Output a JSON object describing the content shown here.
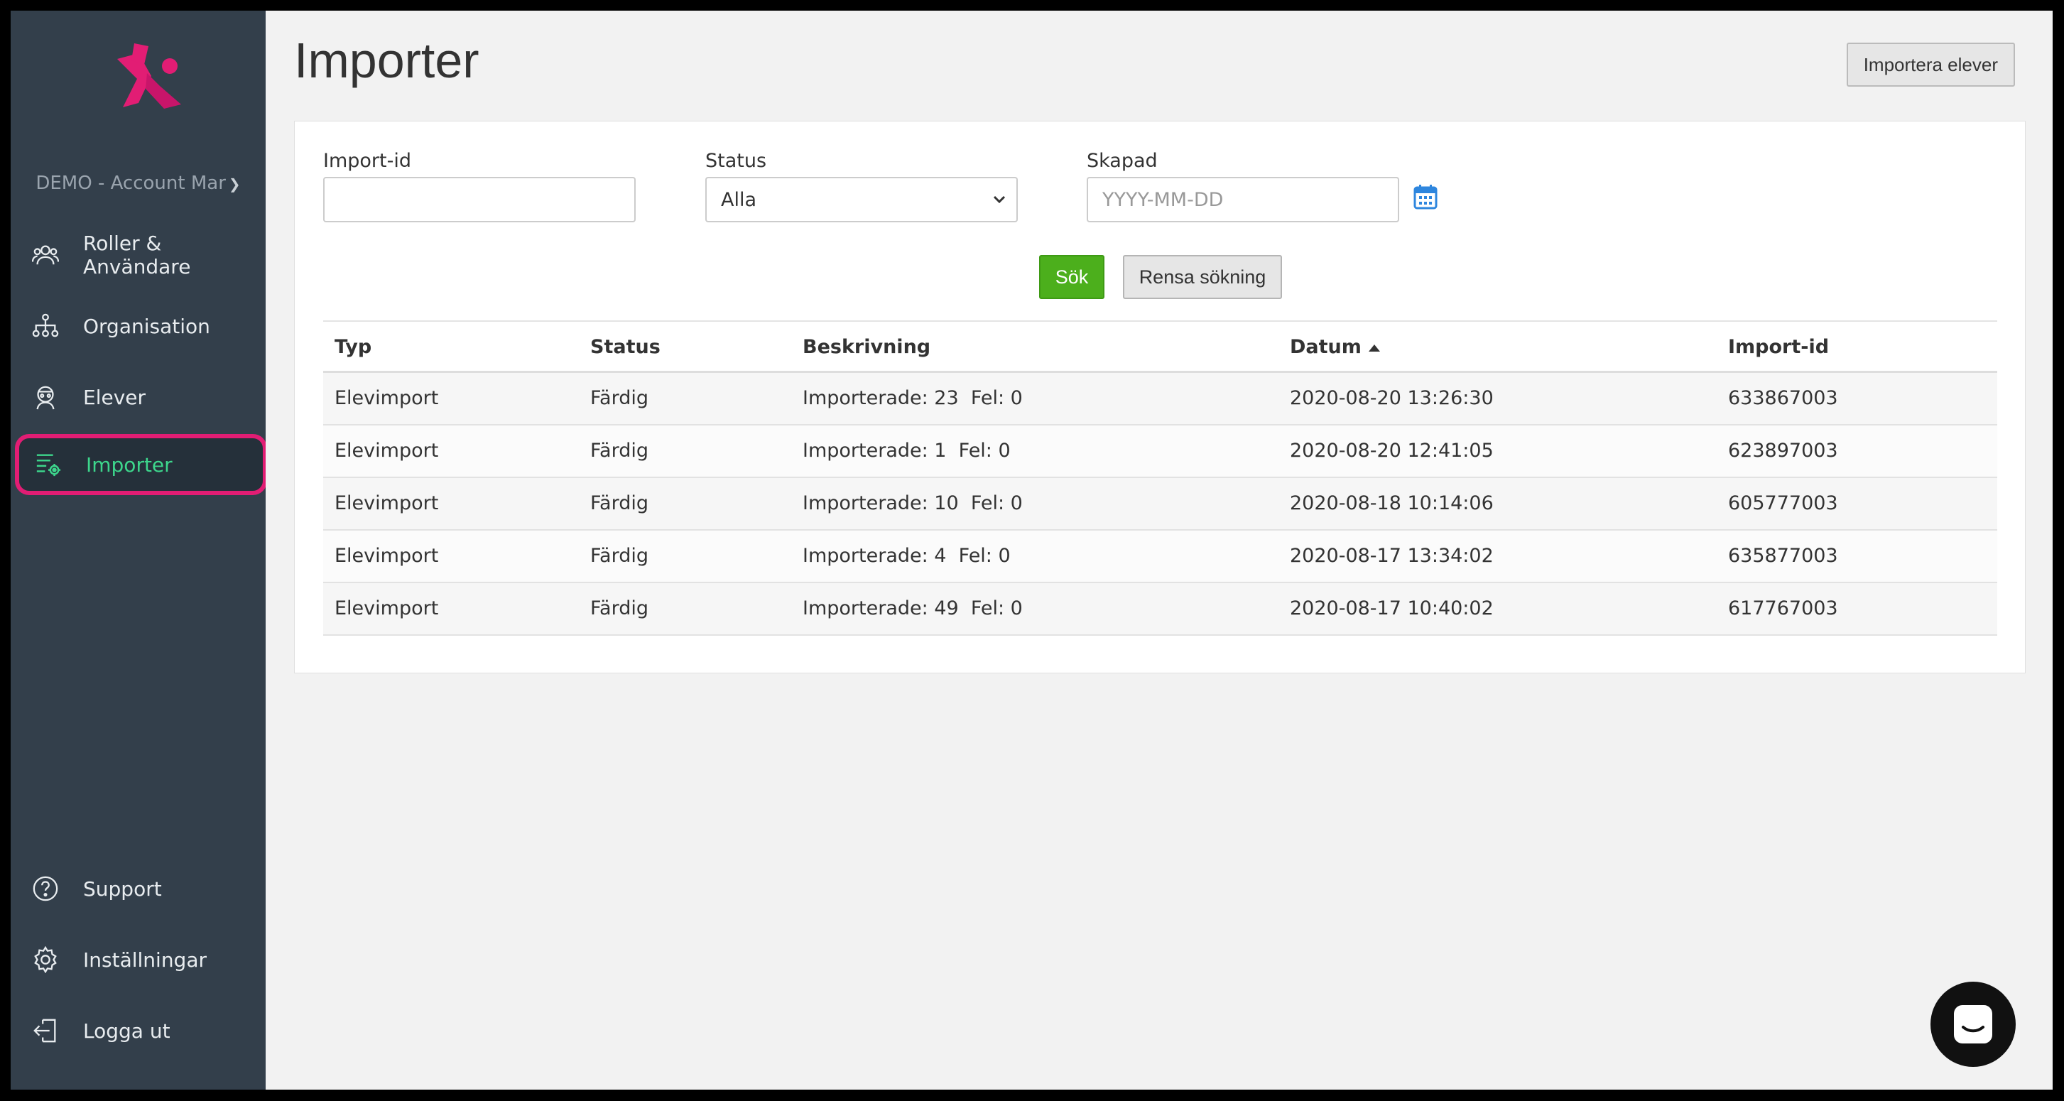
{
  "sidebar": {
    "account": "DEMO - Account Mar",
    "items": [
      {
        "label": "Roller & Användare",
        "icon": "users-icon"
      },
      {
        "label": "Organisation",
        "icon": "org-tree-icon"
      },
      {
        "label": "Elever",
        "icon": "student-icon"
      },
      {
        "label": "Importer",
        "icon": "import-gear-icon",
        "active": true
      }
    ],
    "bottom_items": [
      {
        "label": "Support",
        "icon": "help-icon"
      },
      {
        "label": "Inställningar",
        "icon": "gear-icon"
      },
      {
        "label": "Logga ut",
        "icon": "logout-icon"
      }
    ],
    "colors": {
      "bg": "#333f4b",
      "active_border": "#e21d74",
      "active_text": "#3dd68c",
      "logo": "#e21d74"
    }
  },
  "header": {
    "title": "Importer",
    "import_button": "Importera elever"
  },
  "filters": {
    "import_id_label": "Import-id",
    "import_id_value": "",
    "status_label": "Status",
    "status_value": "Alla",
    "created_label": "Skapad",
    "created_placeholder": "YYYY-MM-DD",
    "search_button": "Sök",
    "clear_button": "Rensa sökning"
  },
  "table": {
    "columns": [
      "Typ",
      "Status",
      "Beskrivning",
      "Datum",
      "Import-id"
    ],
    "sorted_column": "Datum",
    "sort_direction": "asc",
    "rows": [
      {
        "typ": "Elevimport",
        "status": "Färdig",
        "beskrivning": "Importerade: 23  Fel: 0",
        "datum": "2020-08-20 13:26:30",
        "import_id": "633867003"
      },
      {
        "typ": "Elevimport",
        "status": "Färdig",
        "beskrivning": "Importerade: 1  Fel: 0",
        "datum": "2020-08-20 12:41:05",
        "import_id": "623897003"
      },
      {
        "typ": "Elevimport",
        "status": "Färdig",
        "beskrivning": "Importerade: 10  Fel: 0",
        "datum": "2020-08-18 10:14:06",
        "import_id": "605777003"
      },
      {
        "typ": "Elevimport",
        "status": "Färdig",
        "beskrivning": "Importerade: 4  Fel: 0",
        "datum": "2020-08-17 13:34:02",
        "import_id": "635877003"
      },
      {
        "typ": "Elevimport",
        "status": "Färdig",
        "beskrivning": "Importerade: 49  Fel: 0",
        "datum": "2020-08-17 10:40:02",
        "import_id": "617767003"
      }
    ]
  },
  "colors": {
    "search_button": "#4caf1c",
    "calendar_icon": "#2e86de"
  }
}
